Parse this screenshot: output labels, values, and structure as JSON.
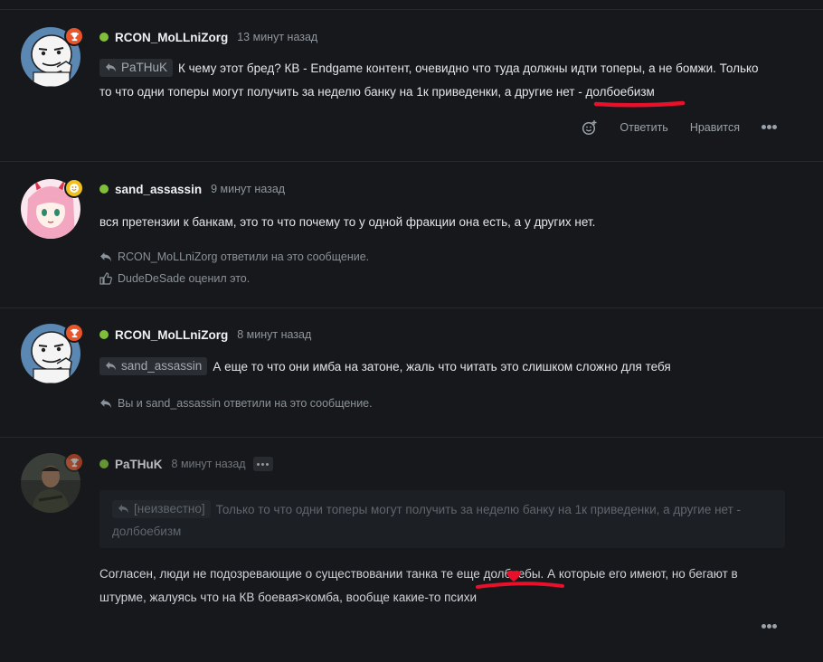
{
  "posts": [
    {
      "author": "RCON_MoLLniZorg",
      "time": "13 минут назад",
      "quote_author": "PaTHuK",
      "text_line1": "К чему этот бред? КВ - Endgame контент, очевидно что туда должны идти топеры, а не бомжи. Только",
      "text_line2": "то что одни топеры могут получить за неделю банку на 1к приведенки, а другие нет - долбоебизм",
      "actions": {
        "reply": "Ответить",
        "like": "Нравится"
      }
    },
    {
      "author": "sand_assassin",
      "time": "9 минут назад",
      "text": "вся претензии к банкам, это то что почему то у одной фракции она есть, а у других нет.",
      "activity_replied": "RCON_MoLLniZorg ответили на это сообщение.",
      "activity_liked": "DudeDeSade оценил это."
    },
    {
      "author": "RCON_MoLLniZorg",
      "time": "8 минут назад",
      "quote_author": "sand_assassin",
      "text": "А еще то что они имба на затоне, жаль что читать это слишком сложно для тебя",
      "activity_replied": "Вы и sand_assassin ответили на это сообщение."
    },
    {
      "author": "PaTHuK",
      "time": "8 минут назад",
      "quote_author": "[неизвестно]",
      "quote_text_line1": "Только то что одни топеры могут получить за неделю банку на 1к приведенки, а другие нет -",
      "quote_text_line2": "долбоебизм",
      "text_line1": "Согласен, люди не подозревающие о существовании танка те еще долбоебы. А которые его имеют, но бегают в",
      "text_line2": "штурме, жалуясь что на КВ боевая>комба, вообще какие-то психи"
    }
  ],
  "colors": {
    "background": "#16181b",
    "online": "#7fbf3a",
    "trophy_badge": "#e8552a",
    "smile_badge": "#f0c020",
    "annotation": "#e8102a"
  },
  "icons": {
    "reply": "reply-arrow-icon",
    "like": "thumbs-up-icon",
    "react": "add-reaction-icon",
    "more": "more-options-icon",
    "trophy": "trophy-icon",
    "smile": "smile-icon"
  }
}
